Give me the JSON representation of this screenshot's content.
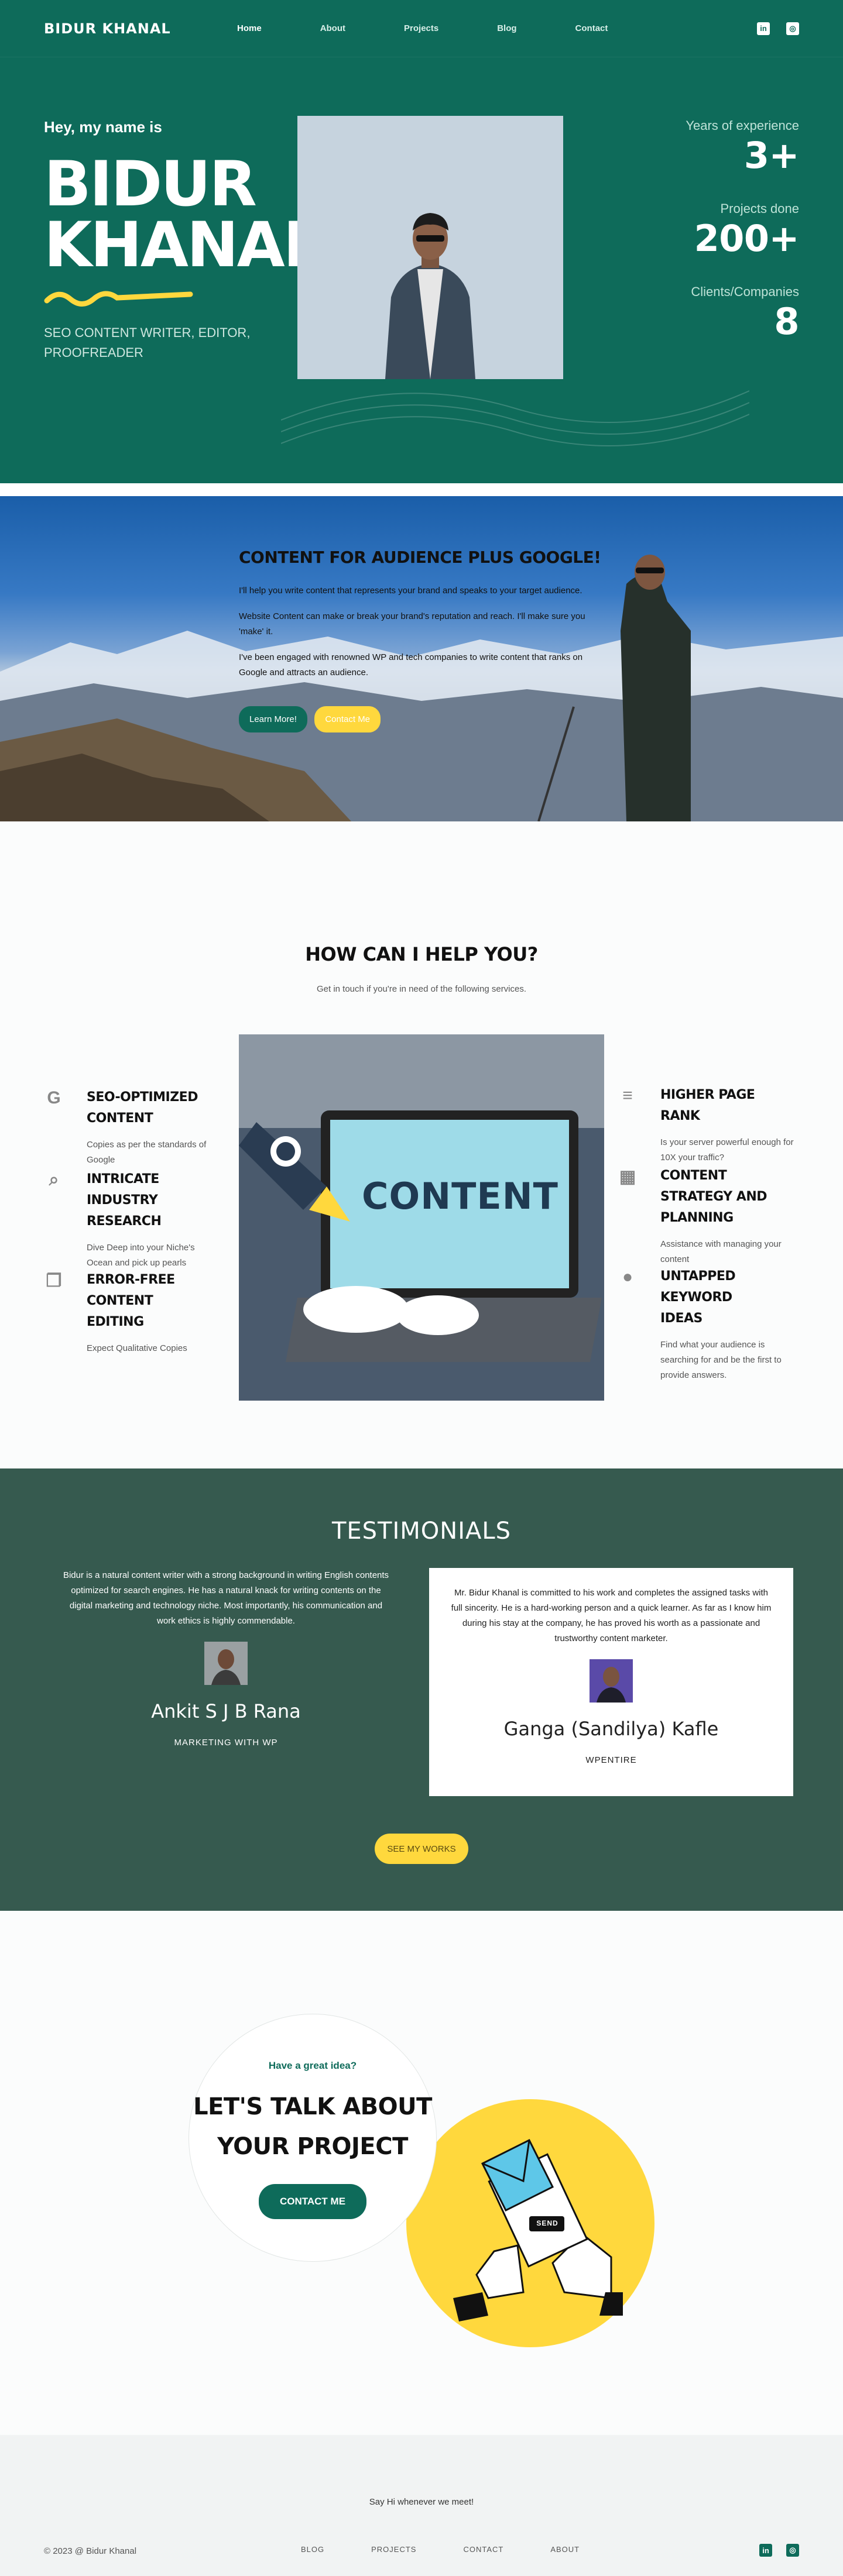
{
  "nav": {
    "logo": "BIDUR KHANAL",
    "items": [
      "Home",
      "About",
      "Projects",
      "Blog",
      "Contact"
    ],
    "icons": [
      "linkedin-icon",
      "instagram-icon"
    ]
  },
  "hero": {
    "greeting": "Hey, my name is",
    "name_line1": "BIDUR",
    "name_line2": "KHANAL",
    "roles": "SEO CONTENT WRITER, EDITOR, PROOFREADER",
    "stats": [
      {
        "label": "Years of experience",
        "value": "3+"
      },
      {
        "label": "Projects done",
        "value": "200+"
      },
      {
        "label": "Clients/Companies",
        "value": "8"
      }
    ]
  },
  "banner": {
    "heading": "CONTENT FOR AUDIENCE PLUS GOOGLE!",
    "paragraphs": [
      "I'll help you write content that represents your brand and speaks to your target audience.",
      "Website Content can make or break your brand's reputation and reach. I'll make sure you 'make' it.",
      "I've been engaged with renowned WP and tech companies to write content that ranks on Google and attracts an audience."
    ],
    "learn_btn": "Learn More!",
    "contact_btn": "Contact Me"
  },
  "services": {
    "heading": "HOW CAN I HELP YOU?",
    "subheading": "Get in touch if you're in need of the following services.",
    "image_word": "CONTENT",
    "left": [
      {
        "icon": "google-icon",
        "title": "SEO-OPTIMIZED CONTENT",
        "desc": "Copies as per the standards of Google"
      },
      {
        "icon": "search-icon",
        "title": "INTRICATE INDUSTRY RESEARCH",
        "desc": "Dive Deep into your Niche's Ocean and pick up pearls"
      },
      {
        "icon": "copy-icon",
        "title": "ERROR-FREE CONTENT EDITING",
        "desc": "Expect Qualitative Copies"
      }
    ],
    "right": [
      {
        "icon": "sort-icon",
        "title": "HIGHER PAGE RANK",
        "desc": "Is your server powerful enough for 10X your traffic?"
      },
      {
        "icon": "calendar-icon",
        "title": "CONTENT STRATEGY AND PLANNING",
        "desc": "Assistance with managing your content"
      },
      {
        "icon": "lightbulb-icon",
        "title": "UNTAPPED KEYWORD IDEAS",
        "desc": "Find what your audience is searching for and be the first to provide answers."
      }
    ]
  },
  "testimonials": {
    "heading": "TESTIMONIALS",
    "items": [
      {
        "text": "Bidur is a natural content writer with a strong background in writing English contents optimized for search engines. He has a natural knack for writing contents on the digital marketing and technology niche. Most importantly, his communication and work ethics is highly commendable.",
        "name": "Ankit S J B Rana",
        "company": "MARKETING WITH WP"
      },
      {
        "text": "Mr. Bidur Khanal is committed to his work and completes the assigned tasks with full sincerity. He is a hard-working person and a quick learner. As far as I know him during his stay at the company, he has proved his worth as a passionate and trustworthy content marketer.",
        "name": "Ganga (Sandilya) Kafle",
        "company": "WPENTIRE"
      }
    ],
    "works_btn": "SEE MY WORKS"
  },
  "talk": {
    "tagline": "Have a great idea?",
    "heading_line1": "LET'S TALK ABOUT",
    "heading_line2": "YOUR PROJECT",
    "button": "CONTACT ME",
    "send_label": "SEND"
  },
  "footer": {
    "say_hi": "Say Hi whenever we meet!",
    "copyright": "© 2023 @ Bidur Khanal",
    "links": [
      "BLOG",
      "PROJECTS",
      "CONTACT",
      "ABOUT"
    ]
  },
  "colors": {
    "primary": "#0e6b5a",
    "accent": "#ffd83d",
    "testimonial_bg": "#365a4f"
  }
}
